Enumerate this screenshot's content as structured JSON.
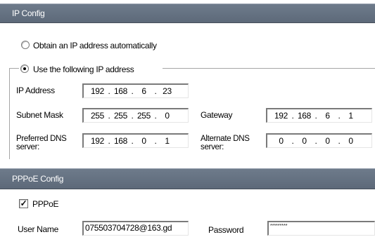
{
  "ip_config": {
    "header": "IP Config",
    "auto_option": "Obtain an IP address automatically",
    "manual_option": "Use the following IP address",
    "selected": "manual",
    "ip_label": "IP Address",
    "ip": [
      "192",
      "168",
      "6",
      "23"
    ],
    "subnet_label": "Subnet Mask",
    "subnet": [
      "255",
      "255",
      "255",
      "0"
    ],
    "gateway_label": "Gateway",
    "gateway": [
      "192",
      "168",
      "6",
      "1"
    ],
    "pref_dns_label_1": "Preferred DNS",
    "pref_dns_label_2": "server:",
    "pref_dns": [
      "192",
      "168",
      "0",
      "1"
    ],
    "alt_dns_label_1": "Alternate DNS",
    "alt_dns_label_2": "server:",
    "alt_dns": [
      "0",
      "0",
      "0",
      "0"
    ]
  },
  "pppoe_config": {
    "header": "PPPoE Config",
    "checkbox_label": "PPPoE",
    "checked": true,
    "username_label": "User Name",
    "username": "075503704728@163.gd",
    "password_label": "Password",
    "password_mask": "*********"
  },
  "colors": {
    "header_bg": "#66727f",
    "header_text": "#ffffff"
  }
}
